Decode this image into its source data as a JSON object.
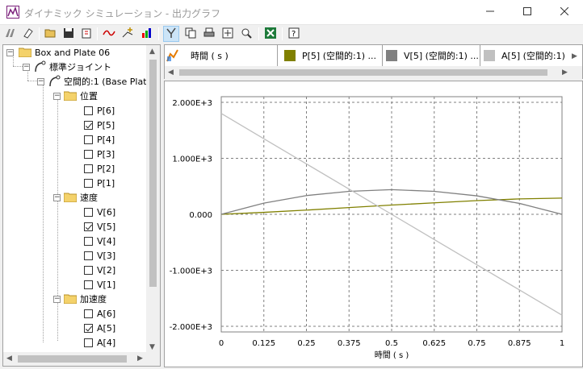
{
  "window": {
    "title": "ダイナミック シミュレーション - 出力グラフ",
    "minimize_icon": "minimize-icon",
    "maximize_icon": "maximize-icon",
    "close_icon": "close-icon"
  },
  "toolbar": {
    "buttons": [
      "clear-icon",
      "eraser-icon",
      "open-folder-icon",
      "save-icon",
      "export-icon",
      "curve-icon",
      "add-point-icon",
      "color-chart-icon",
      "pointer-icon",
      "copy-icon",
      "print-icon",
      "zoom-fit-icon",
      "zoom-icon",
      "excel-icon",
      "help-icon"
    ]
  },
  "tree": {
    "root": "Box and Plate 06",
    "joint": "標準ジョイント",
    "subjoint": "空間的:1 (Base Plate",
    "groups": [
      {
        "label": "位置",
        "items": [
          {
            "label": "P[6]",
            "checked": false
          },
          {
            "label": "P[5]",
            "checked": true
          },
          {
            "label": "P[4]",
            "checked": false
          },
          {
            "label": "P[3]",
            "checked": false
          },
          {
            "label": "P[2]",
            "checked": false
          },
          {
            "label": "P[1]",
            "checked": false
          }
        ]
      },
      {
        "label": "速度",
        "items": [
          {
            "label": "V[6]",
            "checked": false
          },
          {
            "label": "V[5]",
            "checked": true
          },
          {
            "label": "V[4]",
            "checked": false
          },
          {
            "label": "V[3]",
            "checked": false
          },
          {
            "label": "V[2]",
            "checked": false
          },
          {
            "label": "V[1]",
            "checked": false
          }
        ]
      },
      {
        "label": "加速度",
        "items": [
          {
            "label": "A[6]",
            "checked": false
          },
          {
            "label": "A[5]",
            "checked": true
          },
          {
            "label": "A[4]",
            "checked": false
          }
        ]
      }
    ]
  },
  "legend": {
    "x_label": "時間 ( s )",
    "series": [
      {
        "label": "P[5] (空間的:1) ...",
        "color": "#808000"
      },
      {
        "label": "V[5] (空間的:1) ...",
        "color": "#808080"
      },
      {
        "label": "A[5] (空間的:1)",
        "color": "#c0c0c0"
      }
    ]
  },
  "chart_data": {
    "type": "line",
    "xlabel": "時間 ( s )",
    "ylabel": "",
    "xlim": [
      0,
      1
    ],
    "ylim": [
      -2100,
      2100
    ],
    "x_ticks": [
      "0",
      "0.125",
      "0.25",
      "0.375",
      "0.5",
      "0.625",
      "0.75",
      "0.875",
      "1"
    ],
    "y_ticks": [
      "2.000E+3",
      "1.000E+3",
      "0.000",
      "-1.000E+3",
      "-2.000E+3"
    ],
    "y_tick_values": [
      2000,
      1000,
      0,
      -1000,
      -2000
    ],
    "grid": true,
    "series": [
      {
        "name": "P[5] (空間的:1) ...",
        "color": "#808000",
        "x": [
          0,
          0.125,
          0.25,
          0.375,
          0.5,
          0.625,
          0.75,
          0.875,
          1
        ],
        "y": [
          0,
          35,
          75,
          120,
          165,
          205,
          245,
          275,
          290
        ]
      },
      {
        "name": "V[5] (空間的:1) ...",
        "color": "#808080",
        "x": [
          0,
          0.125,
          0.25,
          0.375,
          0.5,
          0.625,
          0.75,
          0.875,
          1
        ],
        "y": [
          0,
          200,
          335,
          410,
          440,
          410,
          330,
          195,
          0
        ]
      },
      {
        "name": "A[5] (空間的:1)",
        "color": "#c0c0c0",
        "x": [
          0,
          0.125,
          0.25,
          0.375,
          0.5,
          0.625,
          0.75,
          0.875,
          1
        ],
        "y": [
          1800,
          1350,
          900,
          450,
          0,
          -450,
          -900,
          -1350,
          -1800
        ]
      }
    ]
  }
}
